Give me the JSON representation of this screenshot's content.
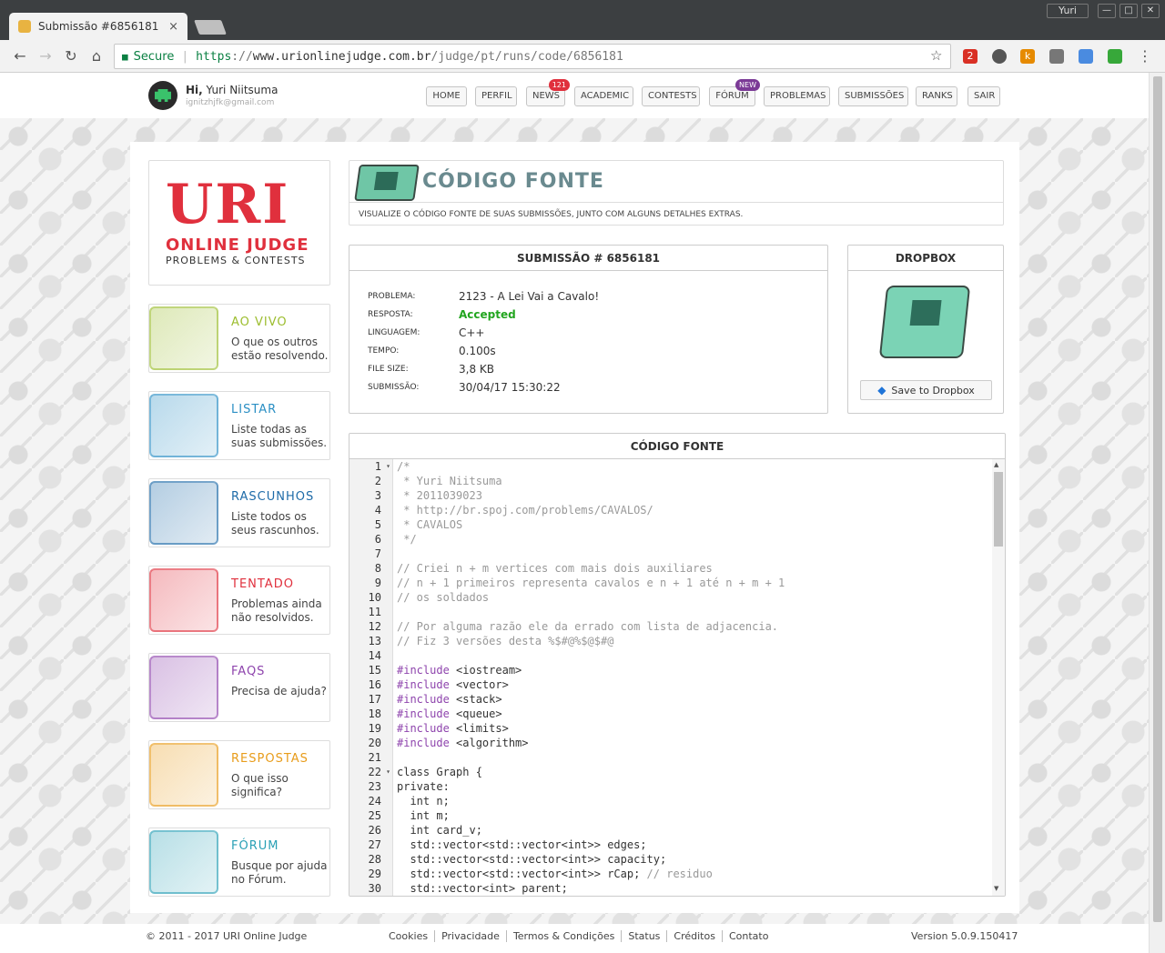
{
  "browser": {
    "tab_title": "Submissão #6856181",
    "tab_close": "×",
    "profile_name": "Yuri",
    "min_label": "—",
    "max_label": "□",
    "close_label": "✕",
    "back": "←",
    "forward": "→",
    "reload": "↻",
    "home": "⌂",
    "secure_label": "Secure",
    "url_scheme": "https",
    "url_sep": "://",
    "url_host": "www.urionlinejudge.com.br",
    "url_path": "/judge/pt/runs/code/6856181",
    "star": "☆",
    "gmail_count": "2",
    "ext_k": "k",
    "menu_dots": "⋮",
    "icons": [
      "gmail-icon",
      "lightbulb-icon",
      "k-icon",
      "camera-icon",
      "translate-icon",
      "tv-icon"
    ]
  },
  "header": {
    "greeting": "Hi,",
    "user_name": "Yuri Niitsuma",
    "email": "ignitzhjfk@gmail.com",
    "menu": [
      {
        "label": "HOME"
      },
      {
        "label": "PERFIL"
      },
      {
        "label": "NEWS",
        "badge": "121",
        "badge_color": "#e0303d"
      },
      {
        "label": "ACADEMIC"
      },
      {
        "label": "CONTESTS"
      },
      {
        "label": "FÓRUM",
        "badge": "NEW",
        "badge_color": "#7b3a96"
      },
      {
        "label": "PROBLEMAS"
      },
      {
        "label": "SUBMISSÕES"
      },
      {
        "label": "RANKS"
      },
      {
        "label": "SAIR"
      }
    ]
  },
  "logo": {
    "uri": "URI",
    "online_judge": "ONLINE JUDGE",
    "tagline": "PROBLEMS & CONTESTS",
    "color": "#e0303d"
  },
  "sidebar": [
    {
      "title": "AO VIVO",
      "desc": "O que os outros estão resolvendo.",
      "color": "#9cbd2e",
      "icon": "globe-clock-icon"
    },
    {
      "title": "LISTAR",
      "desc": "Liste todas as suas submissões.",
      "color": "#2b8fc4",
      "icon": "documents-icon"
    },
    {
      "title": "RASCUNHOS",
      "desc": "Liste todos os seus rascunhos.",
      "color": "#1e6ba8",
      "icon": "pens-icon"
    },
    {
      "title": "TENTADO",
      "desc": "Problemas ainda não resolvidos.",
      "color": "#e0303d",
      "icon": "burning-box-icon"
    },
    {
      "title": "FAQS",
      "desc": "Precisa de ajuda?",
      "color": "#8e44ad",
      "icon": "question-icon"
    },
    {
      "title": "RESPOSTAS",
      "desc": "O que isso significa?",
      "color": "#e89c1a",
      "icon": "lightbulb-icon"
    },
    {
      "title": "FÓRUM",
      "desc": "Busque por ajuda no Fórum.",
      "color": "#2aa0b5",
      "icon": "forum-icon"
    }
  ],
  "page": {
    "title": "CÓDIGO FONTE",
    "subtitle": "VISUALIZE O CÓDIGO FONTE DE SUAS SUBMISSÕES, JUNTO COM ALGUNS DETALHES EXTRAS."
  },
  "submission": {
    "heading": "SUBMISSÃO # 6856181",
    "fields": [
      {
        "key": "PROBLEMA:",
        "value": "2123 - A Lei Vai a Cavalo!"
      },
      {
        "key": "RESPOSTA:",
        "value": "Accepted",
        "status": "ok"
      },
      {
        "key": "LINGUAGEM:",
        "value": "C++"
      },
      {
        "key": "TEMPO:",
        "value": "0.100s"
      },
      {
        "key": "FILE SIZE:",
        "value": "3,8 KB"
      },
      {
        "key": "SUBMISSÃO:",
        "value": "30/04/17 15:30:22"
      }
    ]
  },
  "dropbox": {
    "heading": "DROPBOX",
    "save_label": "Save to Dropbox",
    "icon": "dropbox-icon"
  },
  "code": {
    "heading": "CÓDIGO FONTE",
    "fold_lines": [
      1,
      22
    ],
    "lines": [
      "/*",
      " * Yuri Niitsuma",
      " * 2011039023",
      " * http://br.spoj.com/problems/CAVALOS/",
      " * CAVALOS",
      " */",
      "",
      "// Criei n + m vertices com mais dois auxiliares",
      "// n + 1 primeiros representa cavalos e n + 1 até n + m + 1",
      "// os soldados",
      "",
      "// Por alguma razão ele da errado com lista de adjacencia.",
      "// Fiz 3 versões desta %$#@%$@$#@",
      "",
      "#include <iostream>",
      "#include <vector>",
      "#include <stack>",
      "#include <queue>",
      "#include <limits>",
      "#include <algorithm>",
      "",
      "class Graph {",
      "private:",
      "  int n;",
      "  int m;",
      "  int card_v;",
      "  std::vector<std::vector<int>> edges;",
      "  std::vector<std::vector<int>> capacity;",
      "  std::vector<std::vector<int>> rCap; // residuo",
      "  std::vector<int> parent;"
    ]
  },
  "footer": {
    "copyright": "© 2011 - 2017 URI Online Judge",
    "links": [
      "Cookies",
      "Privacidade",
      "Termos & Condições",
      "Status",
      "Créditos",
      "Contato"
    ],
    "version": "Version 5.0.9.150417"
  }
}
